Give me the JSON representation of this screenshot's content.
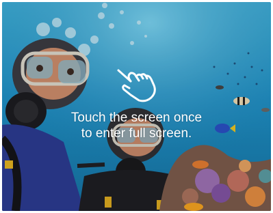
{
  "overlay": {
    "hint_line1": "Touch the screen once",
    "hint_line2": "to enter full screen.",
    "gesture_icon": "tap-hand-icon"
  },
  "video": {
    "subject": "underwater-divers-photo"
  }
}
